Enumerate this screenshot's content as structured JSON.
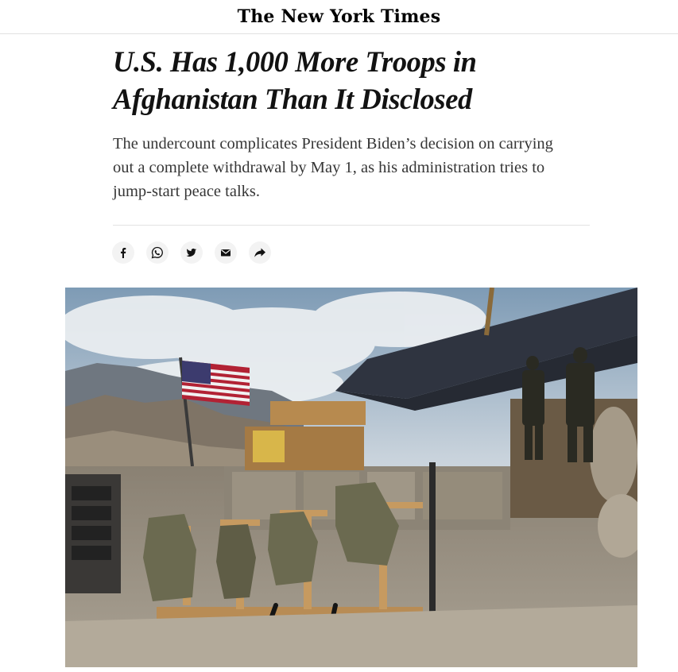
{
  "masthead": {
    "logo_text": "The New York Times"
  },
  "article": {
    "headline_line1": "U.S. Has 1,000 More Troops in",
    "headline_line2": "Afghanistan Than It Disclosed",
    "summary": "The undercount complicates President Biden’s decision on carrying out a complete withdrawal by May 1, as his administration tries to jump-start peace talks."
  },
  "share": {
    "buttons": [
      {
        "icon": "facebook-icon"
      },
      {
        "icon": "whatsapp-icon"
      },
      {
        "icon": "twitter-icon"
      },
      {
        "icon": "email-icon"
      },
      {
        "icon": "share-arrow-icon"
      }
    ]
  },
  "media": {
    "image_subject": "combat outpost with flag and gear"
  },
  "colors": {
    "headline": "#121212",
    "summary": "#363636",
    "divider": "#e2e2e2",
    "share_button_bg": "#f3f3f3"
  }
}
